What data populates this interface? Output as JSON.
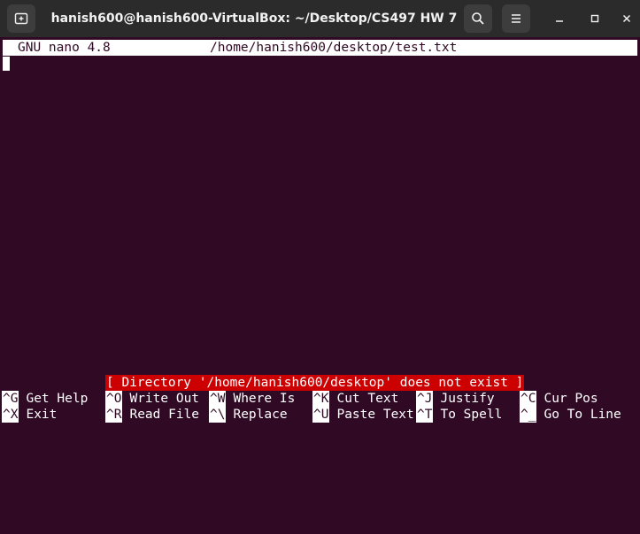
{
  "window": {
    "title": "hanish600@hanish600-VirtualBox: ~/Desktop/CS497 HW 7"
  },
  "colors": {
    "terminal_bg": "#300a24",
    "titlebar_bg": "#2b2b2b",
    "status_bg": "#cc0000",
    "foreground": "#ffffff"
  },
  "icons": {
    "new_tab": "new-tab-icon",
    "search": "search-icon",
    "menu": "hamburger-menu-icon",
    "minimize": "minimize-icon",
    "maximize": "maximize-icon",
    "close": "close-icon"
  },
  "nano": {
    "version": "GNU nano 4.8",
    "filename": "/home/hanish600/desktop/test.txt",
    "status": "[ Directory '/home/hanish600/desktop' does not exist ]",
    "shortcuts_row1": [
      {
        "key": "^G",
        "label": "Get Help"
      },
      {
        "key": "^O",
        "label": "Write Out"
      },
      {
        "key": "^W",
        "label": "Where Is"
      },
      {
        "key": "^K",
        "label": "Cut Text"
      },
      {
        "key": "^J",
        "label": "Justify"
      },
      {
        "key": "^C",
        "label": "Cur Pos"
      }
    ],
    "shortcuts_row2": [
      {
        "key": "^X",
        "label": "Exit"
      },
      {
        "key": "^R",
        "label": "Read File"
      },
      {
        "key": "^\\",
        "label": "Replace"
      },
      {
        "key": "^U",
        "label": "Paste Text"
      },
      {
        "key": "^T",
        "label": "To Spell"
      },
      {
        "key": "^_",
        "label": "Go To Line"
      }
    ]
  }
}
